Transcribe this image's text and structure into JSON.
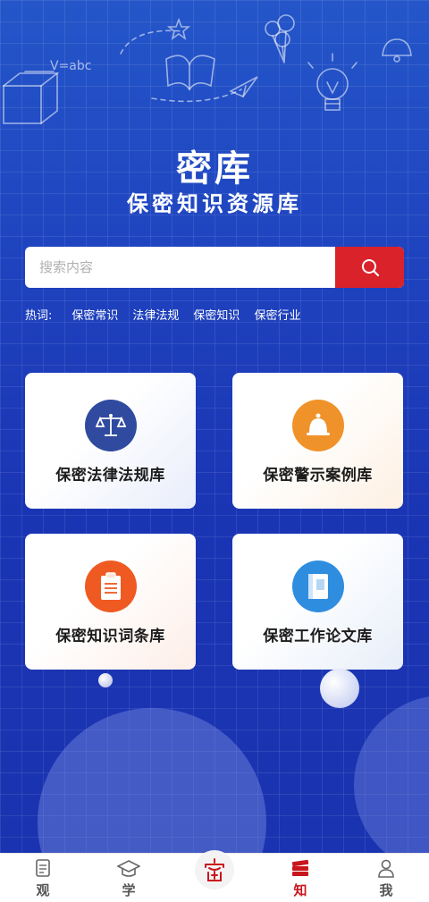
{
  "app": {
    "title": "密库",
    "subtitle": "保密知识资源库"
  },
  "search": {
    "placeholder": "搜索内容",
    "button_icon": "search-icon"
  },
  "hot": {
    "label": "热词:",
    "tags": [
      "保密常识",
      "法律法规",
      "保密知识",
      "保密行业"
    ]
  },
  "cards": [
    {
      "label": "保密法律法规库",
      "icon": "scales-icon",
      "color": "#2f4a9e"
    },
    {
      "label": "保密警示案例库",
      "icon": "bell-icon",
      "color": "#f0922a"
    },
    {
      "label": "保密知识词条库",
      "icon": "clipboard-icon",
      "color": "#ee5a22"
    },
    {
      "label": "保密工作论文库",
      "icon": "book-icon",
      "color": "#2f8de0"
    }
  ],
  "tabbar": {
    "items": [
      {
        "label": "观",
        "icon": "document-icon",
        "active": false
      },
      {
        "label": "学",
        "icon": "graduation-cap-icon",
        "active": false
      },
      {
        "label": "",
        "icon": "seal-logo-icon",
        "active": false
      },
      {
        "label": "知",
        "icon": "books-icon",
        "active": true
      },
      {
        "label": "我",
        "icon": "person-icon",
        "active": false
      }
    ]
  },
  "colors": {
    "accent": "#d9222a",
    "background": "#1f43bf",
    "active_tab": "#c8161d"
  },
  "doodle_text": "V=abc"
}
